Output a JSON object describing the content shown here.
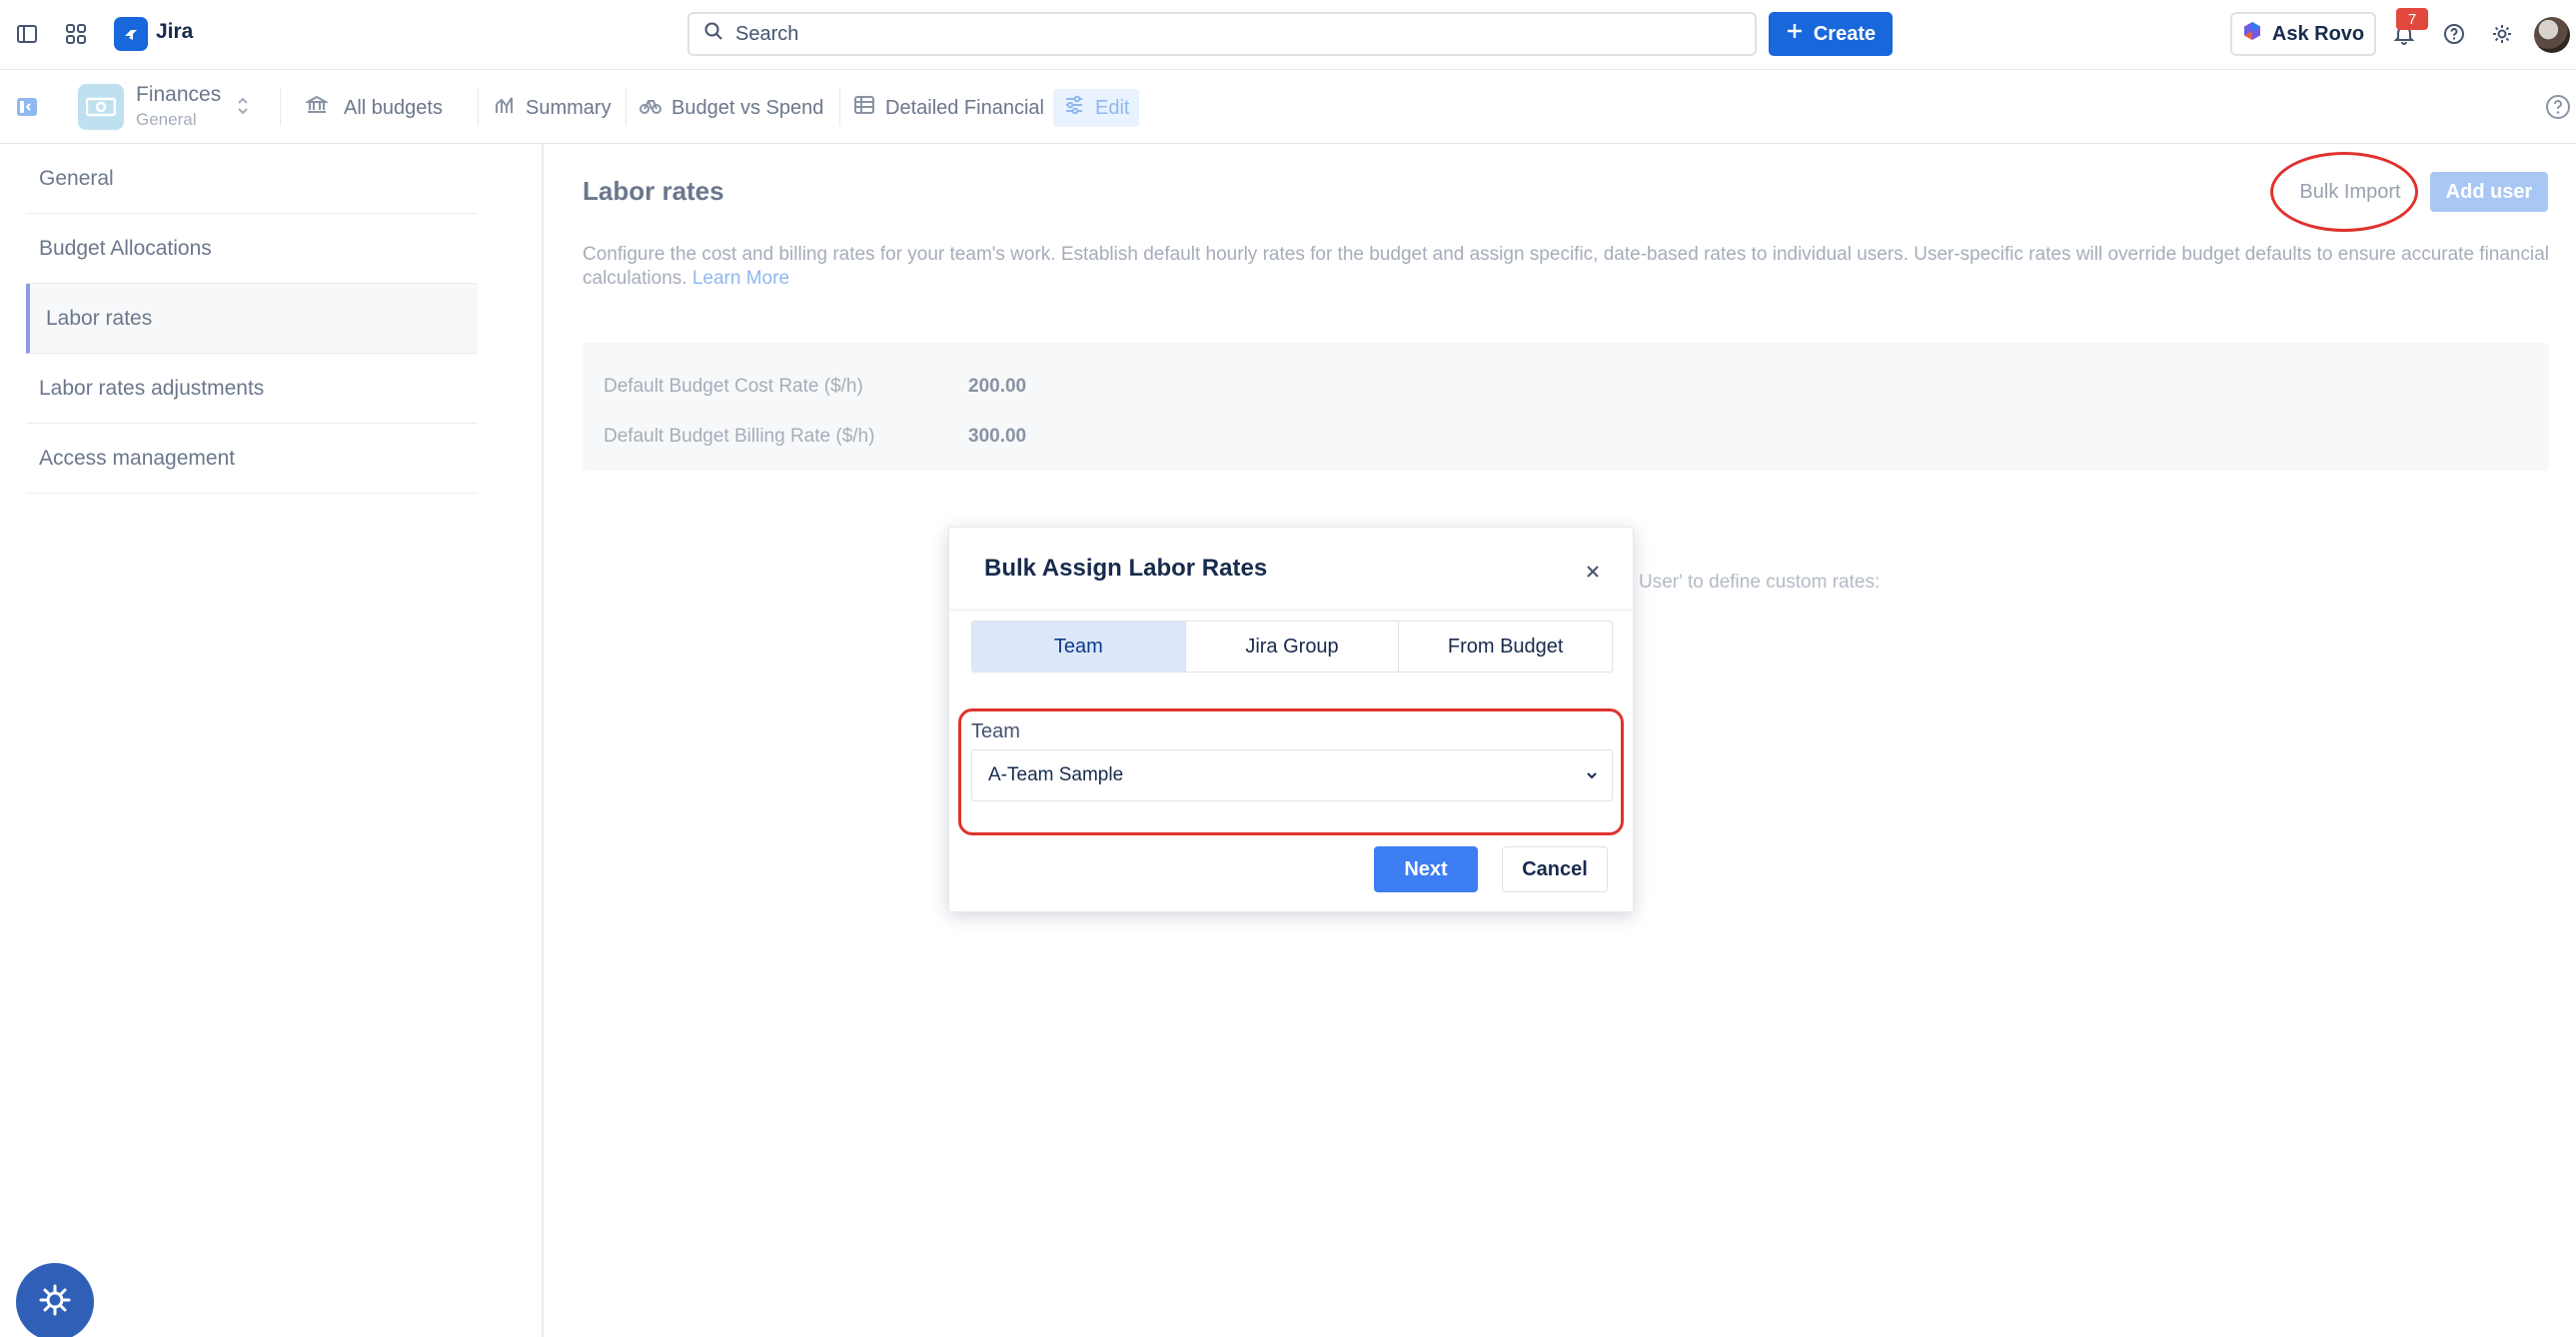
{
  "topnav": {
    "app_name": "Jira",
    "search_placeholder": "Search",
    "create_label": "Create",
    "ask_rovo_label": "Ask Rovo",
    "notification_count": "7"
  },
  "subnav": {
    "project_name": "Finances",
    "project_sub": "General",
    "tabs": [
      {
        "label": "All budgets",
        "icon": "bank-icon"
      },
      {
        "label": "Summary",
        "icon": "chart-icon"
      },
      {
        "label": "Budget vs Spend",
        "icon": "bike-icon"
      },
      {
        "label": "Detailed Financial",
        "icon": "table-icon"
      },
      {
        "label": "Edit",
        "icon": "sliders-icon"
      }
    ]
  },
  "sidebar": {
    "items": [
      {
        "label": "General"
      },
      {
        "label": "Budget Allocations"
      },
      {
        "label": "Labor rates"
      },
      {
        "label": "Labor rates adjustments"
      },
      {
        "label": "Access management"
      }
    ]
  },
  "main": {
    "title": "Labor rates",
    "bulk_import_label": "Bulk Import",
    "add_user_label": "Add user",
    "description": "Configure the cost and billing rates for your team's work. Establish default hourly rates for the budget and assign specific, date-based rates to individual users. User-specific rates will override budget defaults to ensure accurate financial calculations.",
    "learn_more": "Learn More",
    "rates": [
      {
        "label": "Default Budget Cost Rate ($/h)",
        "value": "200.00"
      },
      {
        "label": "Default Budget Billing Rate ($/h)",
        "value": "300.00"
      }
    ],
    "background_hint": "User' to define custom rates:"
  },
  "modal": {
    "title": "Bulk Assign Labor Rates",
    "tabs": [
      "Team",
      "Jira Group",
      "From Budget"
    ],
    "active_tab": "Team",
    "field_label": "Team",
    "selected_team": "A-Team Sample",
    "next_label": "Next",
    "cancel_label": "Cancel"
  },
  "colors": {
    "primary": "#1868db",
    "annotation_red": "#e0322c",
    "active_tab_bg": "#dde7fa"
  }
}
